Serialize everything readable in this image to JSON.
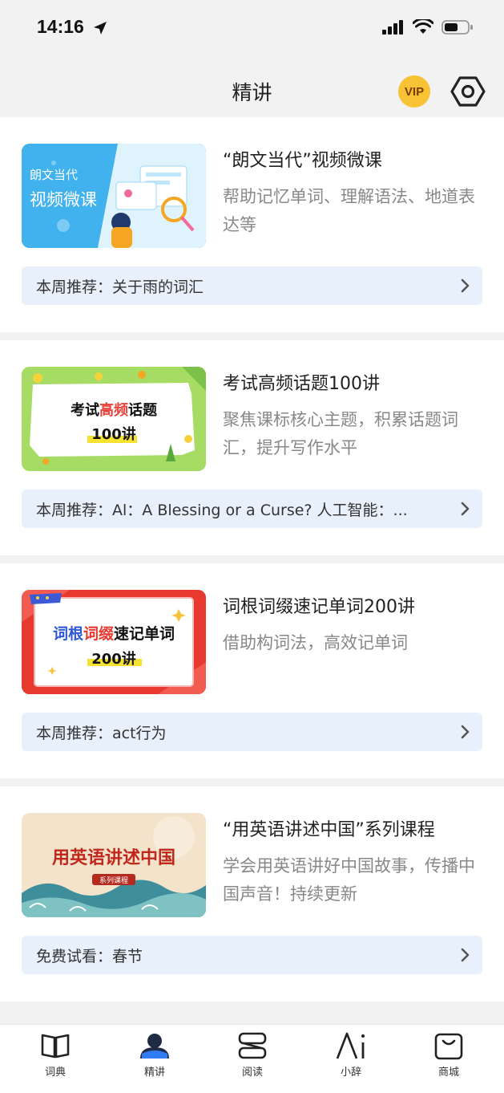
{
  "status": {
    "time": "14:16"
  },
  "header": {
    "title": "精讲",
    "vip_label": "VIP"
  },
  "cards": [
    {
      "title": "“朗文当代”视频微课",
      "desc": "帮助记忆单词、理解语法、地道表达等",
      "rec": "本周推荐：关于雨的词汇",
      "thumb": {
        "line1": "朗文当代",
        "line2": "视频微课"
      }
    },
    {
      "title": "考试高频话题100讲",
      "desc": "聚焦课标核心主题，积累话题词汇，提升写作水平",
      "rec": "本周推荐：Al：A Blessing or a Curse?  人工智能：...",
      "thumb": {
        "line1_a": "考试",
        "line1_b": "高频",
        "line1_c": "话题",
        "line2": "100讲"
      }
    },
    {
      "title": "词根词缀速记单词200讲",
      "desc": "借助构词法，高效记单词",
      "rec": "本周推荐：act行为",
      "thumb": {
        "line1_a": "词根",
        "line1_b": "词缀",
        "line1_c": "速记单词",
        "line2": "200讲"
      }
    },
    {
      "title": "“用英语讲述中国”系列课程",
      "desc": "学会用英语讲好中国故事，传播中国声音！持续更新",
      "rec": "免费试看：春节",
      "thumb": {
        "line1": "用英语讲述中国",
        "line2": "系列课程"
      }
    }
  ],
  "tabs": [
    {
      "label": "词典",
      "icon": "book-icon"
    },
    {
      "label": "精讲",
      "icon": "lecture-icon",
      "active": true
    },
    {
      "label": "阅读",
      "icon": "reading-icon"
    },
    {
      "label": "小辞",
      "icon": "ai-icon"
    },
    {
      "label": "商城",
      "icon": "shopping-bag-icon"
    }
  ],
  "colors": {
    "accent": "#2f7cf6",
    "rec_bg": "#e8f0fb",
    "vip": "#f7c234"
  }
}
